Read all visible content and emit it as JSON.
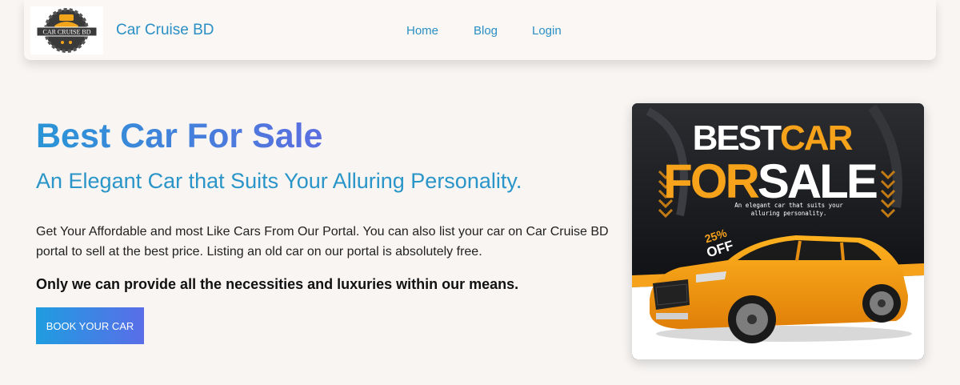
{
  "nav": {
    "brand": "Car Cruise BD",
    "links": [
      {
        "label": "Home"
      },
      {
        "label": "Blog"
      },
      {
        "label": "Login"
      }
    ],
    "logo_text": "CAR CRUISE BD"
  },
  "hero": {
    "title": "Best Car For Sale",
    "subtitle": "An Elegant Car that Suits Your Alluring Personality.",
    "description": "Get Your Affordable and most Like Cars From Our Portal. You can also list your car on Car Cruise BD portal to sell at the best price. Listing an old car on our portal is absolutely free.",
    "tagline": "Only we can provide all the necessities and luxuries within our means.",
    "cta_label": "BOOK YOUR CAR"
  },
  "promo": {
    "line1_white": "BEST",
    "line1_orange": "CAR",
    "line2_orange": "FOR",
    "line2_white": "SALE",
    "caption_line1": "An elegant car that suits your",
    "caption_line2": "alluring personality.",
    "discount_value": "25%",
    "discount_label": "OFF",
    "accent_color": "#f7a21b"
  },
  "colors": {
    "link": "#2a8fc4",
    "gradient_start": "#1f9de0",
    "gradient_end": "#5a6de8",
    "background": "#f8f5f3"
  }
}
